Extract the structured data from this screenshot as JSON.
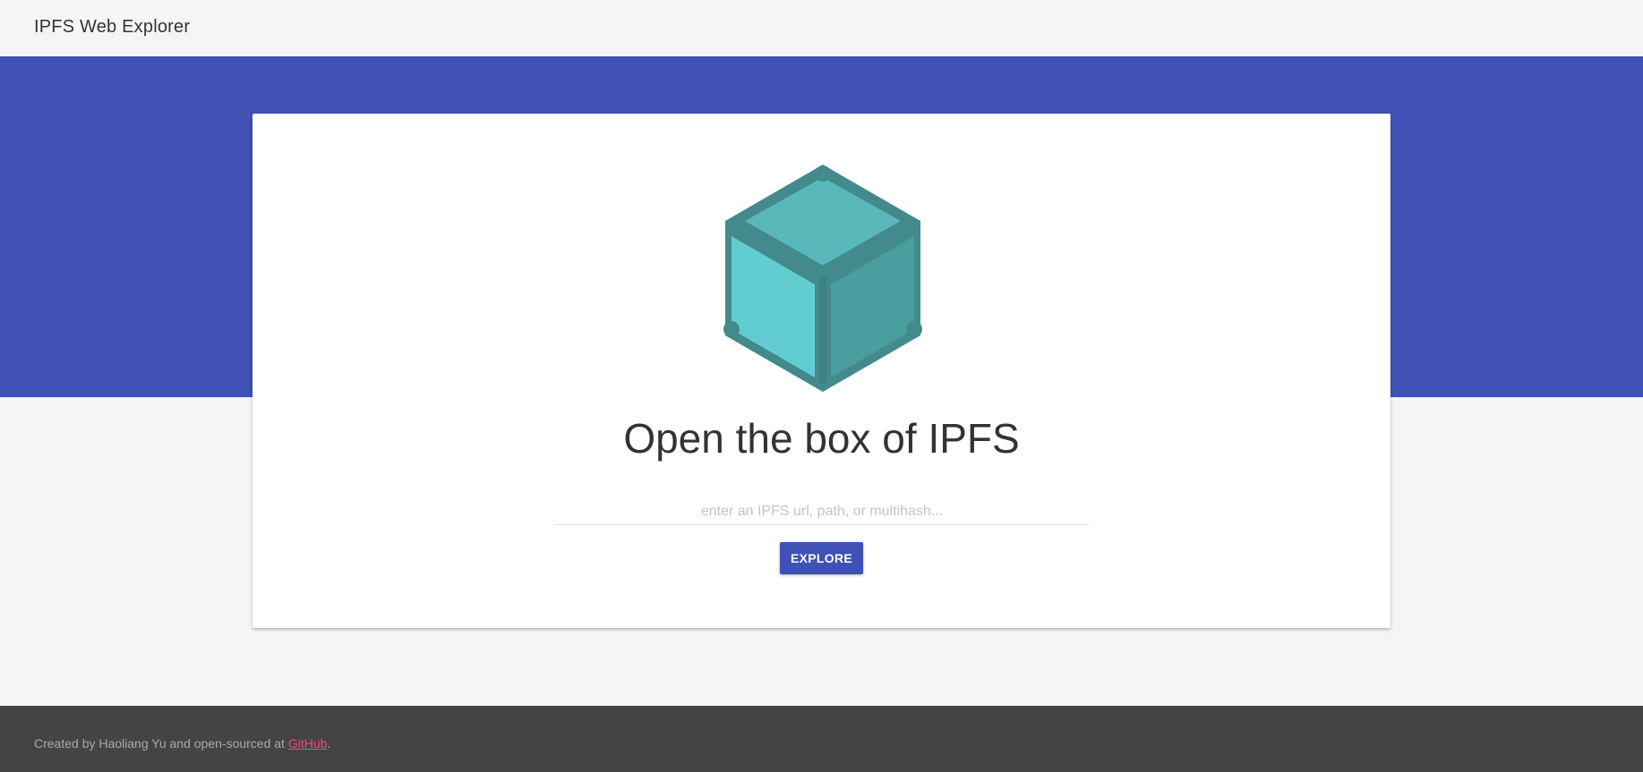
{
  "app": {
    "title": "IPFS Web Explorer"
  },
  "hero": {
    "icon": "ipfs-cube-logo",
    "headline": "Open the box of IPFS"
  },
  "search": {
    "value": "",
    "placeholder": "enter an IPFS url, path, or multihash..."
  },
  "actions": {
    "explore_label": "EXPLORE"
  },
  "footer": {
    "prefix": "Created by Haoliang Yu and open-sourced at ",
    "link_label": "GitHub",
    "suffix": "."
  },
  "colors": {
    "primary": "#3f51b5",
    "background": "#f5f5f5",
    "footer": "#444444",
    "link": "#ff4081",
    "cube_light": "#5ab8ba",
    "cube_left": "#62cdd0",
    "cube_right": "#4b9ea0",
    "cube_frame": "#428a8c"
  }
}
